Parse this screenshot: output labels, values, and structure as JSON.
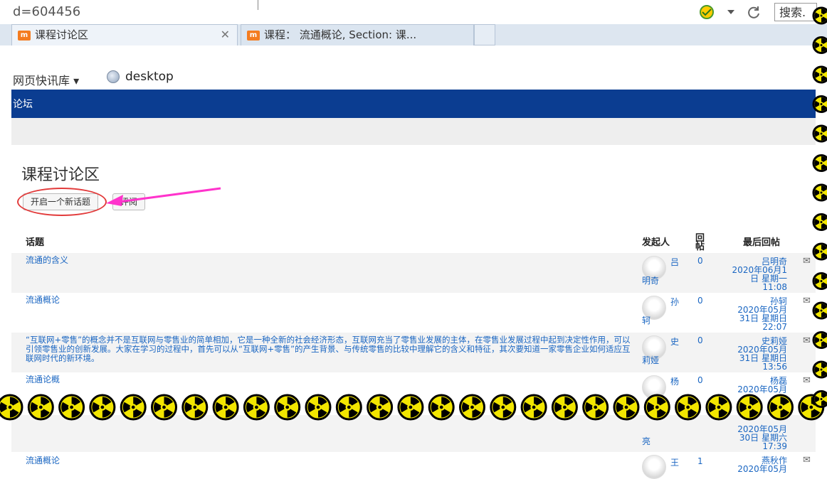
{
  "browser": {
    "url_fragment": "d=604456",
    "search_label": "搜索.",
    "tabs": [
      {
        "label": "课程讨论区",
        "favicon": "m"
      },
      {
        "label": "课程： 流通概论, Section: 课...",
        "favicon": "m"
      }
    ],
    "bookmarks": {
      "folder": "网页快讯库 ▾",
      "desktop": "desktop"
    }
  },
  "site": {
    "nav_label": "论坛"
  },
  "page": {
    "title": "课程讨论区",
    "new_topic_button": "开启一个新话题",
    "subscribe_button": "评阅",
    "columns": {
      "topic": "话题",
      "author": "发起人",
      "replies": "回帖",
      "last_post": "最后回帖"
    },
    "rows": [
      {
        "topic": "流通的含义",
        "author1": "吕",
        "author2": "明奇",
        "replies": "0",
        "last": [
          "吕明奇",
          "2020年06月1",
          "日 星期一",
          "11:08"
        ]
      },
      {
        "topic": "流通概论",
        "author1": "孙",
        "author2": "轲",
        "replies": "0",
        "last": [
          "孙轲",
          "2020年05月",
          "31日 星期日",
          "22:07"
        ]
      },
      {
        "topic": "“互联网+零售”的概念并不是互联网与零售业的简单相加，它是一种全新的社会经济形态，互联网充当了零售业发展的主体，在零售业发展过程中起到决定性作用，可以引领零售业的创新发展。大家在学习的过程中，首先可以从“互联网+零售”的产生背景、与传统零售的比较中理解它的含义和特征，其次要知道一家零售企业如何适应互联网时代的新环境。",
        "author1": "史",
        "author2": "莉娅",
        "replies": "0",
        "last": [
          "史莉娅",
          "2020年05月",
          "31日 星期日",
          "13:56"
        ]
      },
      {
        "topic": "流通论概",
        "author1": "杨",
        "author2": "",
        "replies": "0",
        "last": [
          "杨磊",
          "2020年05月"
        ]
      },
      {
        "topic": "",
        "author1": "",
        "author2": "亮",
        "replies": "",
        "last": [
          "2020年05月",
          "30日 星期六",
          "17:39"
        ]
      },
      {
        "topic": "流通概论",
        "author1": "王",
        "author2": "",
        "replies": "1",
        "last": [
          "燕秋作",
          "2020年05月"
        ]
      }
    ]
  },
  "colors": {
    "site_bar": "#0b3d91",
    "link": "#1a66c2",
    "annotation": "#ff33cc",
    "hazard": "#f2e600"
  }
}
